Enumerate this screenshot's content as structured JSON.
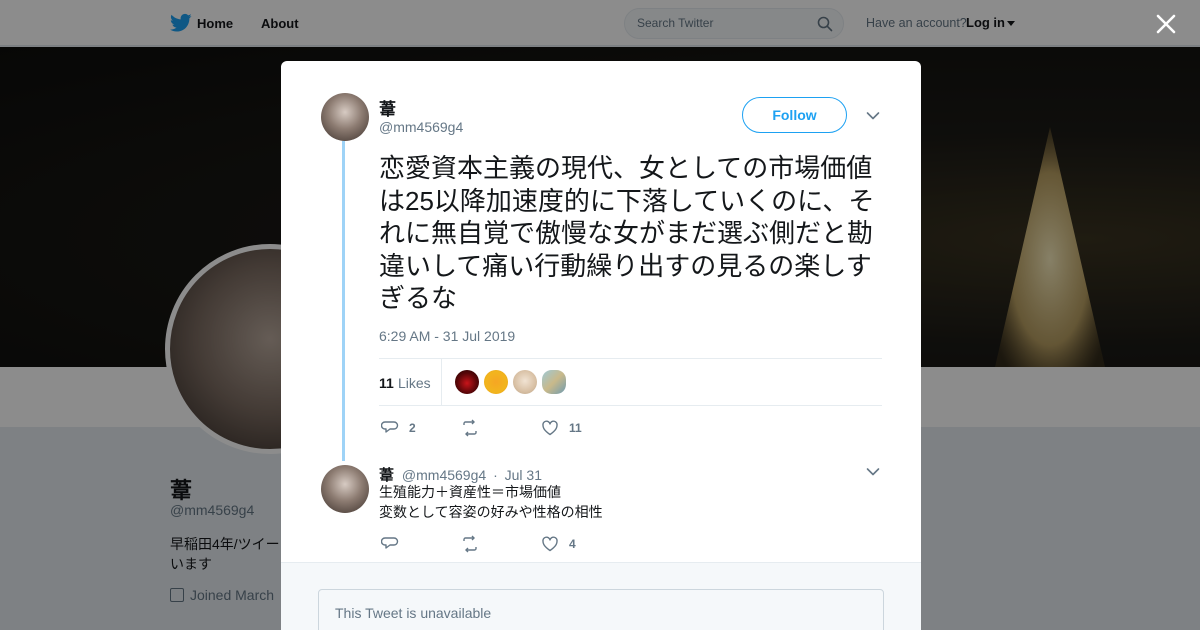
{
  "nav": {
    "home_label": "Home",
    "about_label": "About",
    "search_placeholder": "Search Twitter",
    "account_prompt": "Have an account?",
    "login_label": "Log in",
    "brand_color": "#1da1f2"
  },
  "profile": {
    "name": "葦",
    "handle": "@mm4569g4",
    "bio": "早稲田4年/ツイー\nいます",
    "joined": "Joined March"
  },
  "tweet": {
    "author_name": "葦",
    "author_handle": "@mm4569g4",
    "follow_label": "Follow",
    "text": "恋愛資本主義の現代、女としての市場価値は25以降加速度的に下落していくのに、それに無自覚で傲慢な女がまだ選ぶ側だと勘違いして痛い行動繰り出すの見るの楽しすぎるな",
    "timestamp": "6:29 AM - 31 Jul 2019",
    "likes_count": "11",
    "likes_label": "Likes",
    "likers": [
      "liker-avatar-1",
      "liker-avatar-2",
      "liker-avatar-3",
      "liker-avatar-4"
    ],
    "replies": "2",
    "retweets": "",
    "likes": "11"
  },
  "reply": {
    "author_name": "葦",
    "author_handle": "@mm4569g4",
    "separator": "·",
    "date": "Jul 31",
    "line1": "生殖能力＋資産性＝市場価値",
    "line2": "変数として容姿の好みや性格の相性",
    "replies": "",
    "retweets": "",
    "likes": "4"
  },
  "unavailable": {
    "text": "This Tweet is unavailable"
  }
}
